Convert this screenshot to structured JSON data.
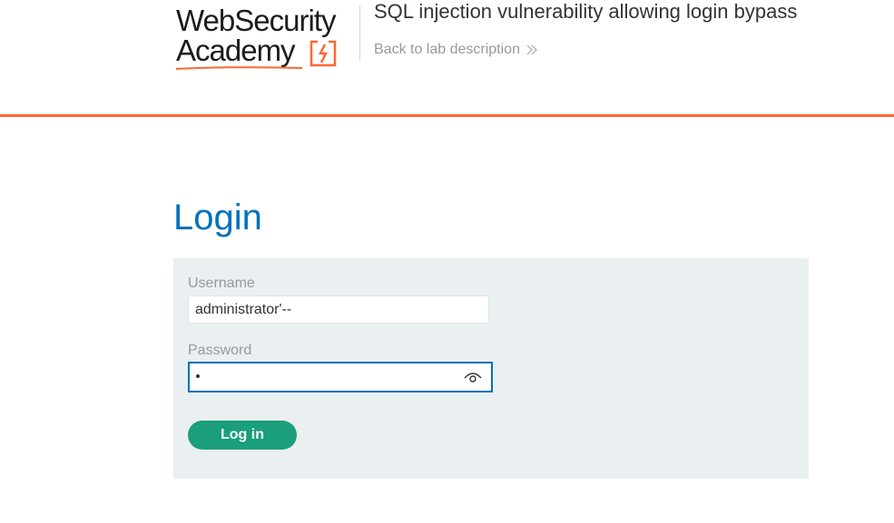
{
  "header": {
    "logo": {
      "line1": "WebSecurity",
      "line2": "Academy",
      "brand_color": "#ff6633"
    },
    "lab_title": "SQL injection vulnerability allowing login bypass",
    "back_link": {
      "label": "Back to lab description",
      "icon": "chevron-double-right-icon"
    }
  },
  "main": {
    "title": "Login",
    "form": {
      "username_label": "Username",
      "username_value": "administrator'--",
      "password_label": "Password",
      "password_value": "•",
      "show_password_icon": "eye-icon",
      "submit_label": "Log in"
    }
  },
  "colors": {
    "accent_orange": "#ff6633",
    "title_blue": "#0071bc",
    "button_green": "#1a9e7b",
    "panel_bg": "#eaeff1"
  }
}
